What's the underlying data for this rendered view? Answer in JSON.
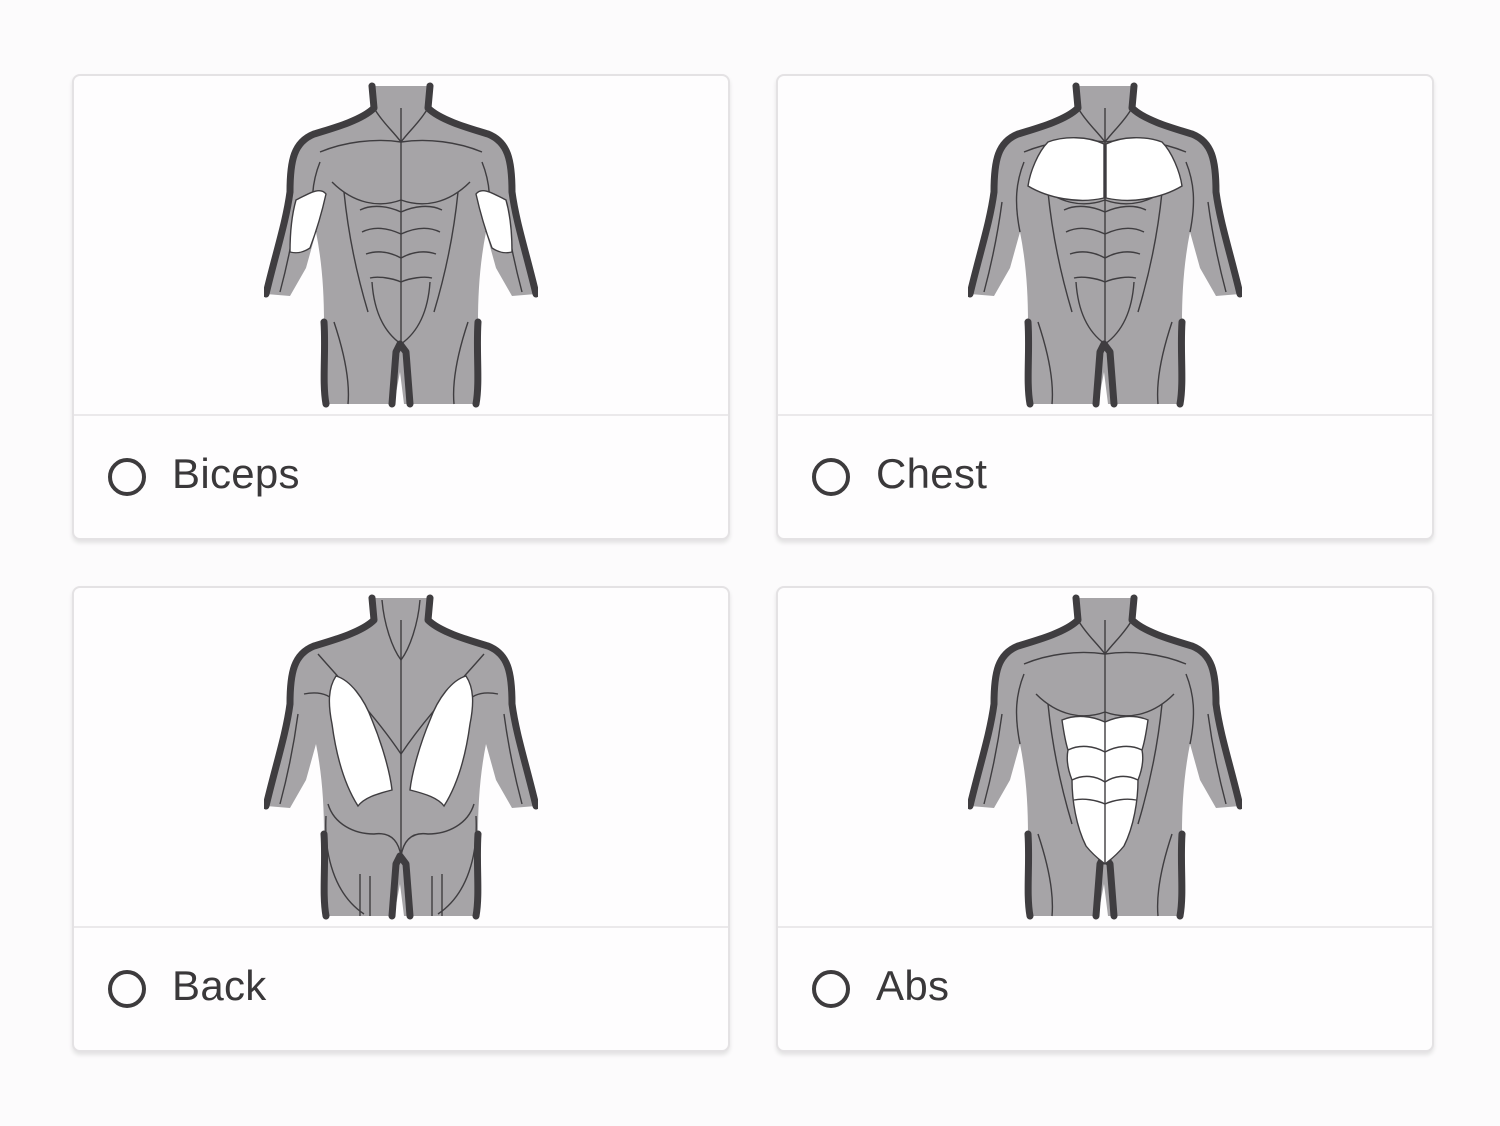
{
  "options": [
    {
      "label": "Biceps",
      "figure_icon": "front-torso-biceps-highlight",
      "selected": false
    },
    {
      "label": "Chest",
      "figure_icon": "front-torso-chest-highlight",
      "selected": false
    },
    {
      "label": "Back",
      "figure_icon": "back-torso-lats-highlight",
      "selected": false
    },
    {
      "label": "Abs",
      "figure_icon": "front-torso-abs-highlight",
      "selected": false
    }
  ],
  "colors": {
    "body_gray": "#a6a4a7",
    "outline": "#3f3d40",
    "highlight": "#ffffff",
    "card_border": "#e4e2e4"
  }
}
